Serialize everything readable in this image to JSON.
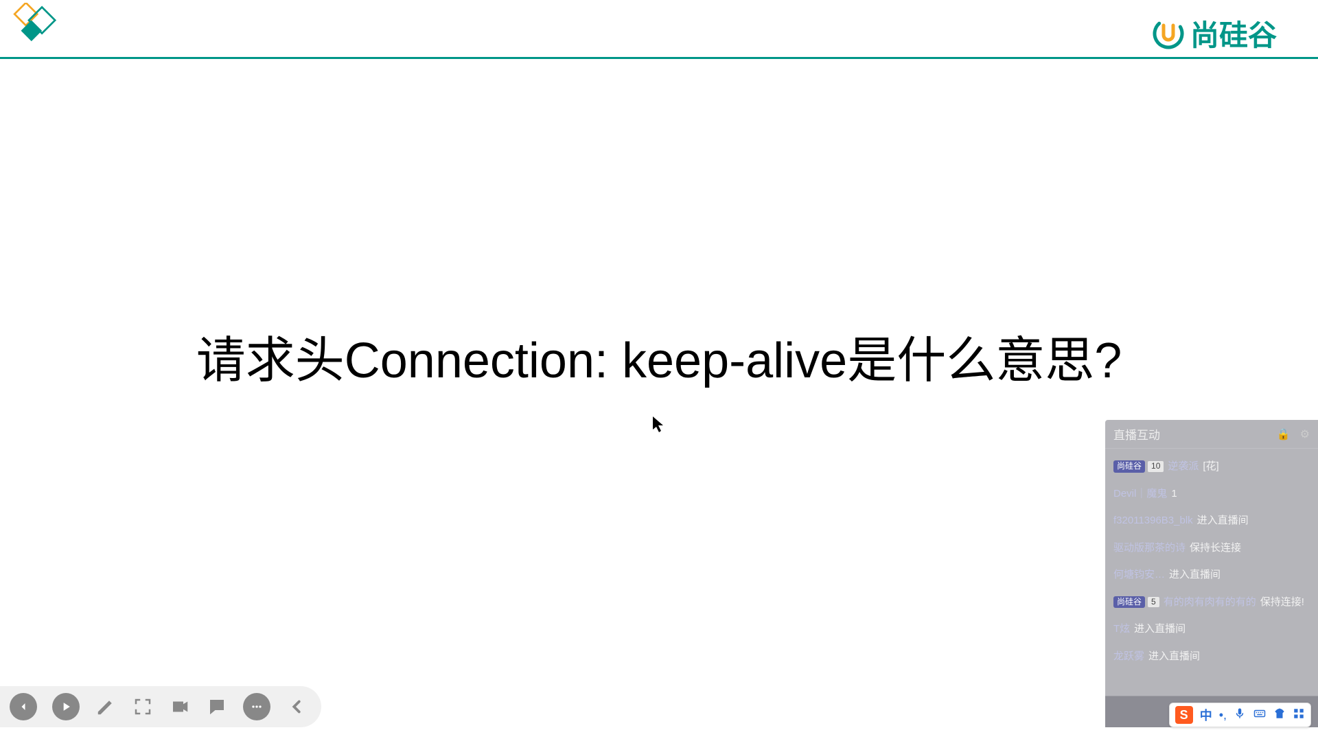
{
  "header": {
    "brand_text": "尚硅谷"
  },
  "slide": {
    "question": "请求头Connection: keep-alive是什么意思?"
  },
  "toolbar": {
    "prev_label": "上一页",
    "play_label": "播放",
    "pen_label": "画笔",
    "focus_label": "聚焦",
    "camera_label": "摄像头",
    "chat_label": "评论",
    "more_label": "更多",
    "collapse_label": "收起"
  },
  "chat": {
    "title": "直播互动",
    "messages": [
      {
        "badge": "尚硅谷",
        "level": "10",
        "user": "逆袭派",
        "text": "[花]"
      },
      {
        "user": "Devil｜魔鬼",
        "text": "1"
      },
      {
        "user": "f32011396B3_blk",
        "text": "进入直播间"
      },
      {
        "user": "驱动版那茶的诗",
        "text": "保持长连接"
      },
      {
        "user": "何塘钧安…",
        "text": "进入直播间"
      },
      {
        "badge": "尚硅谷",
        "level": "5",
        "user": "有的肉有肉有的有的",
        "text": "保持连接!"
      },
      {
        "user": "T炫",
        "text": "进入直播间"
      },
      {
        "user": "龙跃雾",
        "text": "进入直播间"
      }
    ]
  },
  "ime": {
    "logo": "S",
    "lang": "中",
    "punct": "•,",
    "items": [
      "mic",
      "keyboard",
      "skin",
      "grid"
    ]
  }
}
